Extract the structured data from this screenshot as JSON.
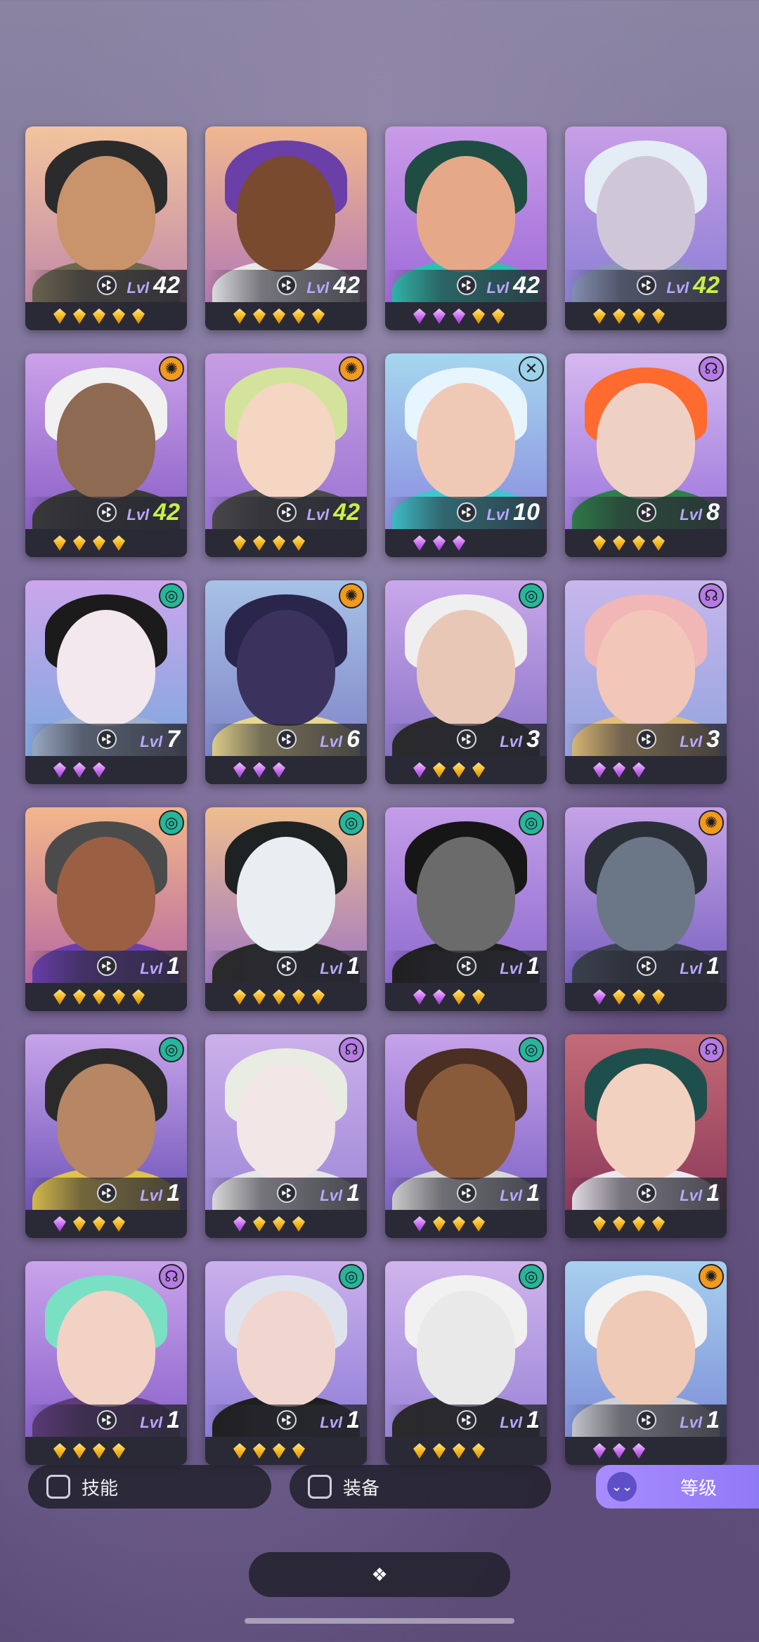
{
  "cards": [
    {
      "level": "42",
      "lvl_label": "Lvl",
      "level_color": "white",
      "faction": null,
      "gems": [
        "gold",
        "gold",
        "gold",
        "gold",
        "gold"
      ],
      "bg": [
        "#f3c49e",
        "#c18aa8"
      ],
      "hair": "#2b2b2b",
      "skin": "#c9936b",
      "cloth": "#6e6750"
    },
    {
      "level": "42",
      "lvl_label": "Lvl",
      "level_color": "white",
      "faction": null,
      "gems": [
        "gold",
        "gold",
        "gold",
        "gold",
        "gold"
      ],
      "bg": [
        "#f0b88e",
        "#b57ab5"
      ],
      "hair": "#6b3fa8",
      "skin": "#7a4a2f",
      "cloth": "#e8e8e8"
    },
    {
      "level": "42",
      "lvl_label": "Lvl",
      "level_color": "white",
      "faction": null,
      "gems": [
        "purple",
        "purple",
        "purple",
        "gold",
        "gold"
      ],
      "bg": [
        "#c99be8",
        "#9d6bd8"
      ],
      "hair": "#1f4c43",
      "skin": "#e5a98a",
      "cloth": "#2fbfb0"
    },
    {
      "level": "42",
      "lvl_label": "Lvl",
      "level_color": "green",
      "faction": null,
      "gems": [
        "gold",
        "gold",
        "gold",
        "gold"
      ],
      "bg": [
        "#c79ee6",
        "#8b7fd4"
      ],
      "hair": "#e4ecf5",
      "skin": "#cfc7d7",
      "cloth": "#8a96b8"
    },
    {
      "level": "42",
      "lvl_label": "Lvl",
      "level_color": "green",
      "faction": {
        "icon": "sun-icon",
        "glyph": "✺",
        "color": "#f29a1e"
      },
      "gems": [
        "gold",
        "gold",
        "gold",
        "gold"
      ],
      "bg": [
        "#cba1ea",
        "#8a5fc6"
      ],
      "hair": "#f1f1f1",
      "skin": "#8e6a52",
      "cloth": "#3a3a3a"
    },
    {
      "level": "42",
      "lvl_label": "Lvl",
      "level_color": "green",
      "faction": {
        "icon": "sun-icon",
        "glyph": "✺",
        "color": "#f29a1e"
      },
      "gems": [
        "gold",
        "gold",
        "gold",
        "gold"
      ],
      "bg": [
        "#c69de4",
        "#9a74d2"
      ],
      "hair": "#d4e39c",
      "skin": "#f4d6c2",
      "cloth": "#4a4a4a"
    },
    {
      "level": "10",
      "lvl_label": "Lvl",
      "level_color": "white",
      "faction": {
        "icon": "void-icon",
        "glyph": "✕",
        "color": "#9ad3ea"
      },
      "gems": [
        "purple",
        "purple",
        "purple"
      ],
      "bg": [
        "#a5d7ee",
        "#8a8ee0"
      ],
      "hair": "#e7f5ff",
      "skin": "#f0c9b6",
      "cloth": "#3fc6cf"
    },
    {
      "level": "8",
      "lvl_label": "Lvl",
      "level_color": "white",
      "faction": {
        "icon": "chaos-icon",
        "glyph": "☊",
        "color": "#b67be6"
      },
      "gems": [
        "gold",
        "gold",
        "gold",
        "gold"
      ],
      "bg": [
        "#d6b8f0",
        "#9c77dc"
      ],
      "hair": "#ff6a2e",
      "skin": "#efd0c4",
      "cloth": "#2f7f4a"
    },
    {
      "level": "7",
      "lvl_label": "Lvl",
      "level_color": "white",
      "faction": {
        "icon": "swirl-icon",
        "glyph": "◎",
        "color": "#27b59b"
      },
      "gems": [
        "purple",
        "purple",
        "purple"
      ],
      "bg": [
        "#cca6ec",
        "#7ea8de"
      ],
      "hair": "#1b1b1b",
      "skin": "#f3e8ee",
      "cloth": "#9fb2cc"
    },
    {
      "level": "6",
      "lvl_label": "Lvl",
      "level_color": "white",
      "faction": {
        "icon": "sun-icon",
        "glyph": "✺",
        "color": "#f29a1e"
      },
      "gems": [
        "purple",
        "purple",
        "purple"
      ],
      "bg": [
        "#a7c2e6",
        "#7f85c8"
      ],
      "hair": "#2a254b",
      "skin": "#3b335e",
      "cloth": "#e8d88f"
    },
    {
      "level": "3",
      "lvl_label": "Lvl",
      "level_color": "white",
      "faction": {
        "icon": "swirl-icon",
        "glyph": "◎",
        "color": "#27b59b"
      },
      "gems": [
        "purple",
        "gold",
        "gold",
        "gold"
      ],
      "bg": [
        "#c9a8ea",
        "#8b73c8"
      ],
      "hair": "#efefef",
      "skin": "#e9c7b7",
      "cloth": "#2b2b2b"
    },
    {
      "level": "3",
      "lvl_label": "Lvl",
      "level_color": "white",
      "faction": {
        "icon": "chaos-icon",
        "glyph": "☊",
        "color": "#b67be6"
      },
      "gems": [
        "purple",
        "purple",
        "purple"
      ],
      "bg": [
        "#c7b7ec",
        "#93a3de"
      ],
      "hair": "#f1b6b6",
      "skin": "#f2c7b9",
      "cloth": "#e3bf78"
    },
    {
      "level": "1",
      "lvl_label": "Lvl",
      "level_color": "white",
      "faction": {
        "icon": "swirl-icon",
        "glyph": "◎",
        "color": "#27b59b"
      },
      "gems": [
        "gold",
        "gold",
        "gold",
        "gold",
        "gold"
      ],
      "bg": [
        "#f3b78b",
        "#b76aa2"
      ],
      "hair": "#4b4b4b",
      "skin": "#9b5f44",
      "cloth": "#6b3fb0"
    },
    {
      "level": "1",
      "lvl_label": "Lvl",
      "level_color": "white",
      "faction": {
        "icon": "swirl-icon",
        "glyph": "◎",
        "color": "#27b59b"
      },
      "gems": [
        "gold",
        "gold",
        "gold",
        "gold",
        "gold"
      ],
      "bg": [
        "#efbe8e",
        "#9f78c2"
      ],
      "hair": "#1f2222",
      "skin": "#e9eef2",
      "cloth": "#2a2a2a"
    },
    {
      "level": "1",
      "lvl_label": "Lvl",
      "level_color": "white",
      "faction": {
        "icon": "swirl-icon",
        "glyph": "◎",
        "color": "#27b59b"
      },
      "gems": [
        "purple",
        "purple",
        "gold",
        "gold"
      ],
      "bg": [
        "#c49de8",
        "#8e6bd0"
      ],
      "hair": "#161616",
      "skin": "#6b6b6b",
      "cloth": "#1f1f1f"
    },
    {
      "level": "1",
      "lvl_label": "Lvl",
      "level_color": "white",
      "faction": {
        "icon": "sun-icon",
        "glyph": "✺",
        "color": "#f29a1e"
      },
      "gems": [
        "purple",
        "gold",
        "gold",
        "gold"
      ],
      "bg": [
        "#c6a3e8",
        "#7a62c0"
      ],
      "hair": "#2b3038",
      "skin": "#6b7686",
      "cloth": "#3b4350"
    },
    {
      "level": "1",
      "lvl_label": "Lvl",
      "level_color": "white",
      "faction": {
        "icon": "swirl-icon",
        "glyph": "◎",
        "color": "#27b59b"
      },
      "gems": [
        "purple",
        "gold",
        "gold",
        "gold"
      ],
      "bg": [
        "#c7a3ea",
        "#6f55b8"
      ],
      "hair": "#2a2a2a",
      "skin": "#b68665",
      "cloth": "#e0c34c"
    },
    {
      "level": "1",
      "lvl_label": "Lvl",
      "level_color": "white",
      "faction": {
        "icon": "chaos-icon",
        "glyph": "☊",
        "color": "#b67be6"
      },
      "gems": [
        "purple",
        "gold",
        "gold",
        "gold"
      ],
      "bg": [
        "#cbb0ea",
        "#9f88d8"
      ],
      "hair": "#e8ece2",
      "skin": "#f3e6e6",
      "cloth": "#e6e6e6"
    },
    {
      "level": "1",
      "lvl_label": "Lvl",
      "level_color": "white",
      "faction": {
        "icon": "swirl-icon",
        "glyph": "◎",
        "color": "#27b59b"
      },
      "gems": [
        "purple",
        "gold",
        "gold",
        "gold"
      ],
      "bg": [
        "#c6a2ea",
        "#7f64c6"
      ],
      "hair": "#4a2f22",
      "skin": "#8a5b3b",
      "cloth": "#d8d8d8"
    },
    {
      "level": "1",
      "lvl_label": "Lvl",
      "level_color": "white",
      "faction": {
        "icon": "chaos-icon",
        "glyph": "☊",
        "color": "#b67be6"
      },
      "gems": [
        "gold",
        "gold",
        "gold",
        "gold"
      ],
      "bg": [
        "#c46b77",
        "#8d3a5a"
      ],
      "hair": "#1f4f4c",
      "skin": "#f3d1c0",
      "cloth": "#efe7ef"
    },
    {
      "level": "1",
      "lvl_label": "Lvl",
      "level_color": "white",
      "faction": {
        "icon": "chaos-icon",
        "glyph": "☊",
        "color": "#b67be6"
      },
      "gems": [
        "gold",
        "gold",
        "gold",
        "gold"
      ],
      "bg": [
        "#c9a4ea",
        "#8a62cc"
      ],
      "hair": "#79e0c4",
      "skin": "#f3d2c6",
      "cloth": "#5e3b7b"
    },
    {
      "level": "1",
      "lvl_label": "Lvl",
      "level_color": "white",
      "faction": {
        "icon": "swirl-icon",
        "glyph": "◎",
        "color": "#27b59b"
      },
      "gems": [
        "gold",
        "gold",
        "gold",
        "gold"
      ],
      "bg": [
        "#cbb0ec",
        "#8f7ed8"
      ],
      "hair": "#dfe3ee",
      "skin": "#f1d6cf",
      "cloth": "#1f1f1f"
    },
    {
      "level": "1",
      "lvl_label": "Lvl",
      "level_color": "white",
      "faction": {
        "icon": "swirl-icon",
        "glyph": "◎",
        "color": "#27b59b"
      },
      "gems": [
        "gold",
        "gold",
        "gold",
        "gold"
      ],
      "bg": [
        "#cfb4ec",
        "#9b84d8"
      ],
      "hair": "#f1f1f1",
      "skin": "#e9e9e9",
      "cloth": "#2a2a2a"
    },
    {
      "level": "1",
      "lvl_label": "Lvl",
      "level_color": "white",
      "faction": {
        "icon": "sun-icon",
        "glyph": "✺",
        "color": "#f29a1e"
      },
      "gems": [
        "purple",
        "purple",
        "purple"
      ],
      "bg": [
        "#a8d0ee",
        "#7d8ed8"
      ],
      "hair": "#f2f2f2",
      "skin": "#efcab6",
      "cloth": "#cfcfd6"
    }
  ],
  "filters": {
    "skill_label": "技能",
    "equipment_label": "装备",
    "sort_label": "等级",
    "sort_icon": "⌄⌄"
  },
  "bottom": {
    "icon": "diamond-cluster-icon",
    "glyph": "❖"
  }
}
